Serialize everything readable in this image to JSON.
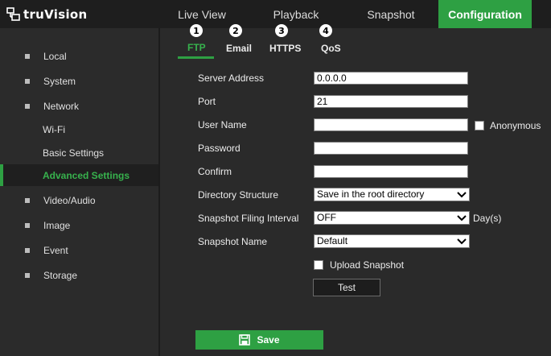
{
  "brand": {
    "logo_text": "truVision"
  },
  "nav": [
    {
      "label": "Live View"
    },
    {
      "label": "Playback"
    },
    {
      "label": "Snapshot"
    },
    {
      "label": "Configuration",
      "active": true
    }
  ],
  "sidebar": {
    "items": [
      {
        "label": "Local"
      },
      {
        "label": "System"
      },
      {
        "label": "Network"
      },
      {
        "label": "Wi-Fi"
      },
      {
        "label": "Basic Settings"
      },
      {
        "label": "Advanced Settings",
        "selected": true
      },
      {
        "label": "Video/Audio"
      },
      {
        "label": "Image"
      },
      {
        "label": "Event"
      },
      {
        "label": "Storage"
      }
    ]
  },
  "tabs": [
    {
      "label": "FTP",
      "badge": "1",
      "active": true
    },
    {
      "label": "Email",
      "badge": "2"
    },
    {
      "label": "HTTPS",
      "badge": "3"
    },
    {
      "label": "QoS",
      "badge": "4"
    }
  ],
  "form": {
    "server_address": {
      "label": "Server Address",
      "value": "0.0.0.0"
    },
    "port": {
      "label": "Port",
      "value": "21"
    },
    "user_name": {
      "label": "User Name",
      "value": ""
    },
    "anonymous": {
      "label": "Anonymous",
      "checked": false
    },
    "password": {
      "label": "Password",
      "value": ""
    },
    "confirm": {
      "label": "Confirm",
      "value": ""
    },
    "directory_structure": {
      "label": "Directory Structure",
      "value": "Save in the root directory"
    },
    "snapshot_interval": {
      "label": "Snapshot Filing Interval",
      "value": "OFF",
      "unit": "Day(s)"
    },
    "snapshot_name": {
      "label": "Snapshot Name",
      "value": "Default"
    },
    "upload_snapshot": {
      "label": "Upload Snapshot",
      "checked": false
    }
  },
  "buttons": {
    "test_label": "Test",
    "save_label": "Save"
  },
  "colors": {
    "accent": "#2ea043",
    "background": "#2a2a2a",
    "header": "#1e1e1e"
  }
}
